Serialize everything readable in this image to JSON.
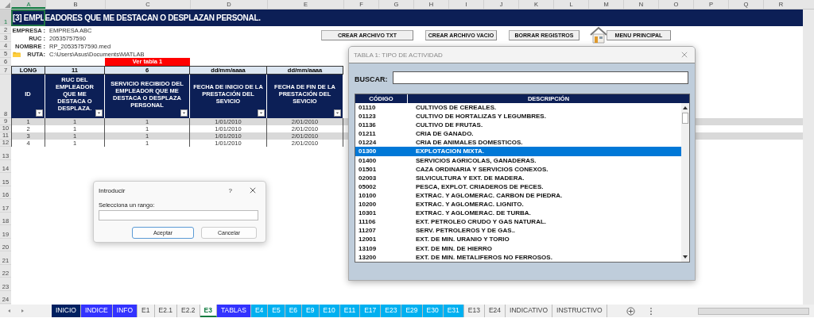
{
  "sheet": {
    "columns": [
      {
        "label": "A",
        "selected": true
      },
      {
        "label": "B",
        "selected": false
      },
      {
        "label": "C",
        "selected": false
      },
      {
        "label": "D",
        "selected": false
      },
      {
        "label": "E",
        "selected": false
      },
      {
        "label": "F",
        "selected": false
      },
      {
        "label": "G",
        "selected": false
      },
      {
        "label": "H",
        "selected": false
      },
      {
        "label": "I",
        "selected": false
      },
      {
        "label": "J",
        "selected": false
      },
      {
        "label": "K",
        "selected": false
      },
      {
        "label": "L",
        "selected": false
      },
      {
        "label": "M",
        "selected": false
      },
      {
        "label": "N",
        "selected": false
      },
      {
        "label": "O",
        "selected": false
      },
      {
        "label": "P",
        "selected": false
      },
      {
        "label": "Q",
        "selected": false
      },
      {
        "label": "R",
        "selected": false
      }
    ],
    "rows": [
      {
        "label": "1",
        "selected": true
      },
      {
        "label": "2",
        "selected": false
      },
      {
        "label": "3",
        "selected": false
      },
      {
        "label": "4",
        "selected": false
      },
      {
        "label": "5",
        "selected": false
      },
      {
        "label": "6",
        "selected": false
      },
      {
        "label": "7",
        "selected": false
      },
      {
        "label": "8",
        "selected": false
      },
      {
        "label": "9",
        "selected": false
      },
      {
        "label": "10",
        "selected": false
      },
      {
        "label": "11",
        "selected": false
      },
      {
        "label": "12",
        "selected": false
      },
      {
        "label": "13",
        "selected": false
      },
      {
        "label": "14",
        "selected": false
      },
      {
        "label": "15",
        "selected": false
      },
      {
        "label": "16",
        "selected": false
      },
      {
        "label": "17",
        "selected": false
      },
      {
        "label": "18",
        "selected": false
      },
      {
        "label": "19",
        "selected": false
      },
      {
        "label": "20",
        "selected": false
      },
      {
        "label": "21",
        "selected": false
      },
      {
        "label": "22",
        "selected": false
      },
      {
        "label": "23",
        "selected": false
      },
      {
        "label": "24",
        "selected": false
      }
    ]
  },
  "title": "[3] EMPLEADORES QUE ME DESTACAN O DESPLAZAN PERSONAL.",
  "info": [
    {
      "kind": "text",
      "label": "EMPRESA :",
      "value": "EMPRESA ABC"
    },
    {
      "kind": "text",
      "label": "RUC :",
      "value": "20535757590"
    },
    {
      "kind": "text",
      "label": "NOMBRE :",
      "value": "RP_20535757590.med"
    },
    {
      "kind": "folder",
      "label": "RUTA:",
      "value": "C:\\Users\\Asus\\Documents\\MATLAB"
    }
  ],
  "table_link": "Ver tabla 1",
  "table": {
    "formats": [
      "LONG",
      "11",
      "6",
      "dd/mm/aaaa",
      "dd/mm/aaaa"
    ],
    "columns": [
      "ID",
      "RUC DEL EMPLEADOR QUE ME DESTACA O DESPLAZA.",
      "SERVICIO RECIBIDO DEL EMPLEADOR QUE ME DESTACA O DESPLAZA PERSONAL",
      "FECHA DE INICIO DE LA PRESTACIÓN DEL SEVICIO",
      "FECHA DE FIN DE LA PRESTACIÓN DEL SEVICIO"
    ],
    "rows": [
      [
        "1",
        "1",
        "1",
        "1/01/2010",
        "2/01/2010"
      ],
      [
        "2",
        "1",
        "1",
        "1/01/2010",
        "2/01/2010"
      ],
      [
        "3",
        "1",
        "1",
        "1/01/2010",
        "2/01/2010"
      ],
      [
        "4",
        "1",
        "1",
        "1/01/2010",
        "2/01/2010"
      ]
    ]
  },
  "buttons": [
    "CREAR ARCHIVO TXT",
    "CREAR ARCHIVO VACIO",
    "BORRAR REGISTROS"
  ],
  "menu_button": "MENU PRINCIPAL",
  "activity_dialog": {
    "title": "TABLA 1: TIPO DE ACTIVIDAD",
    "search_label": "BUSCAR:",
    "columns": [
      "CÓDIGO",
      "DESCRIPCIÓN"
    ],
    "rows": [
      {
        "code": "01110",
        "description": "CULTIVOS DE CEREALES.",
        "selected": false
      },
      {
        "code": "01123",
        "description": "CULTIVO DE HORTALIZAS Y LEGUMBRES.",
        "selected": false
      },
      {
        "code": "01136",
        "description": "CULTIVO DE FRUTAS.",
        "selected": false
      },
      {
        "code": "01211",
        "description": "CRIA DE GANADO.",
        "selected": false
      },
      {
        "code": "01224",
        "description": "CRIA DE ANIMALES DOMESTICOS.",
        "selected": false
      },
      {
        "code": "01300",
        "description": "EXPLOTACION MIXTA.",
        "selected": true
      },
      {
        "code": "01400",
        "description": "SERVICIOS AGRICOLAS, GANADERAS.",
        "selected": false
      },
      {
        "code": "01501",
        "description": "CAZA ORDINARIA Y SERVICIOS CONEXOS.",
        "selected": false
      },
      {
        "code": "02003",
        "description": "SILVICULTURA Y EXT. DE MADERA.",
        "selected": false
      },
      {
        "code": "05002",
        "description": "PESCA, EXPLOT. CRIADEROS DE PECES.",
        "selected": false
      },
      {
        "code": "10100",
        "description": "EXTRAC. Y  AGLOMERAC. CARBON DE PIEDRA.",
        "selected": false
      },
      {
        "code": "10200",
        "description": "EXTRAC. Y AGLOMERAC. LIGNITO.",
        "selected": false
      },
      {
        "code": "10301",
        "description": "EXTRAC. Y AGLOMERAC. DE TURBA.",
        "selected": false
      },
      {
        "code": "11106",
        "description": "EXT. PETROLEO CRUDO Y GAS NATURAL.",
        "selected": false
      },
      {
        "code": "11207",
        "description": "SERV. PETROLEROS Y DE GAS..",
        "selected": false
      },
      {
        "code": "12001",
        "description": "EXT. DE MIN. URANIO Y TORIO",
        "selected": false
      },
      {
        "code": "13109",
        "description": "EXT. DE MIN. DE HIERRO",
        "selected": false
      },
      {
        "code": "13200",
        "description": "EXT. DE MIN. METALIFEROS NO FERROSOS.",
        "selected": false
      }
    ]
  },
  "input_dialog": {
    "title": "Introducir",
    "help": "?",
    "prompt": "Selecciona un rango:",
    "buttons": [
      {
        "label": "Aceptar",
        "focused": true
      },
      {
        "label": "Cancelar",
        "focused": false
      }
    ]
  },
  "sheet_tabs": [
    {
      "label": "INICIO",
      "selected": false,
      "color": "#002060"
    },
    {
      "label": "INDICE",
      "selected": false,
      "color": "#3333ff"
    },
    {
      "label": "INFO",
      "selected": false,
      "color": "#3333ff"
    },
    {
      "label": "E1",
      "selected": false
    },
    {
      "label": "E2.1",
      "selected": false
    },
    {
      "label": "E2.2",
      "selected": false
    },
    {
      "label": "E3",
      "selected": true
    },
    {
      "label": "TABLAS",
      "selected": false,
      "color": "#3333ff"
    },
    {
      "label": "E4",
      "selected": false,
      "color": "#00b0f0"
    },
    {
      "label": "E5",
      "selected": false,
      "color": "#00b0f0"
    },
    {
      "label": "E6",
      "selected": false,
      "color": "#00b0f0"
    },
    {
      "label": "E9",
      "selected": false,
      "color": "#00b0f0"
    },
    {
      "label": "E10",
      "selected": false,
      "color": "#00b0f0"
    },
    {
      "label": "E11",
      "selected": false,
      "color": "#00b0f0"
    },
    {
      "label": "E17",
      "selected": false,
      "color": "#00b0f0"
    },
    {
      "label": "E23",
      "selected": false,
      "color": "#00b0f0"
    },
    {
      "label": "E29",
      "selected": false,
      "color": "#00b0f0"
    },
    {
      "label": "E30",
      "selected": false,
      "color": "#00b0f0"
    },
    {
      "label": "E31",
      "selected": false,
      "color": "#00b0f0"
    },
    {
      "label": "E13",
      "selected": false
    },
    {
      "label": "E24",
      "selected": false
    },
    {
      "label": "INDICATIVO",
      "selected": false
    },
    {
      "label": "INSTRUCTIVO",
      "selected": false
    }
  ]
}
